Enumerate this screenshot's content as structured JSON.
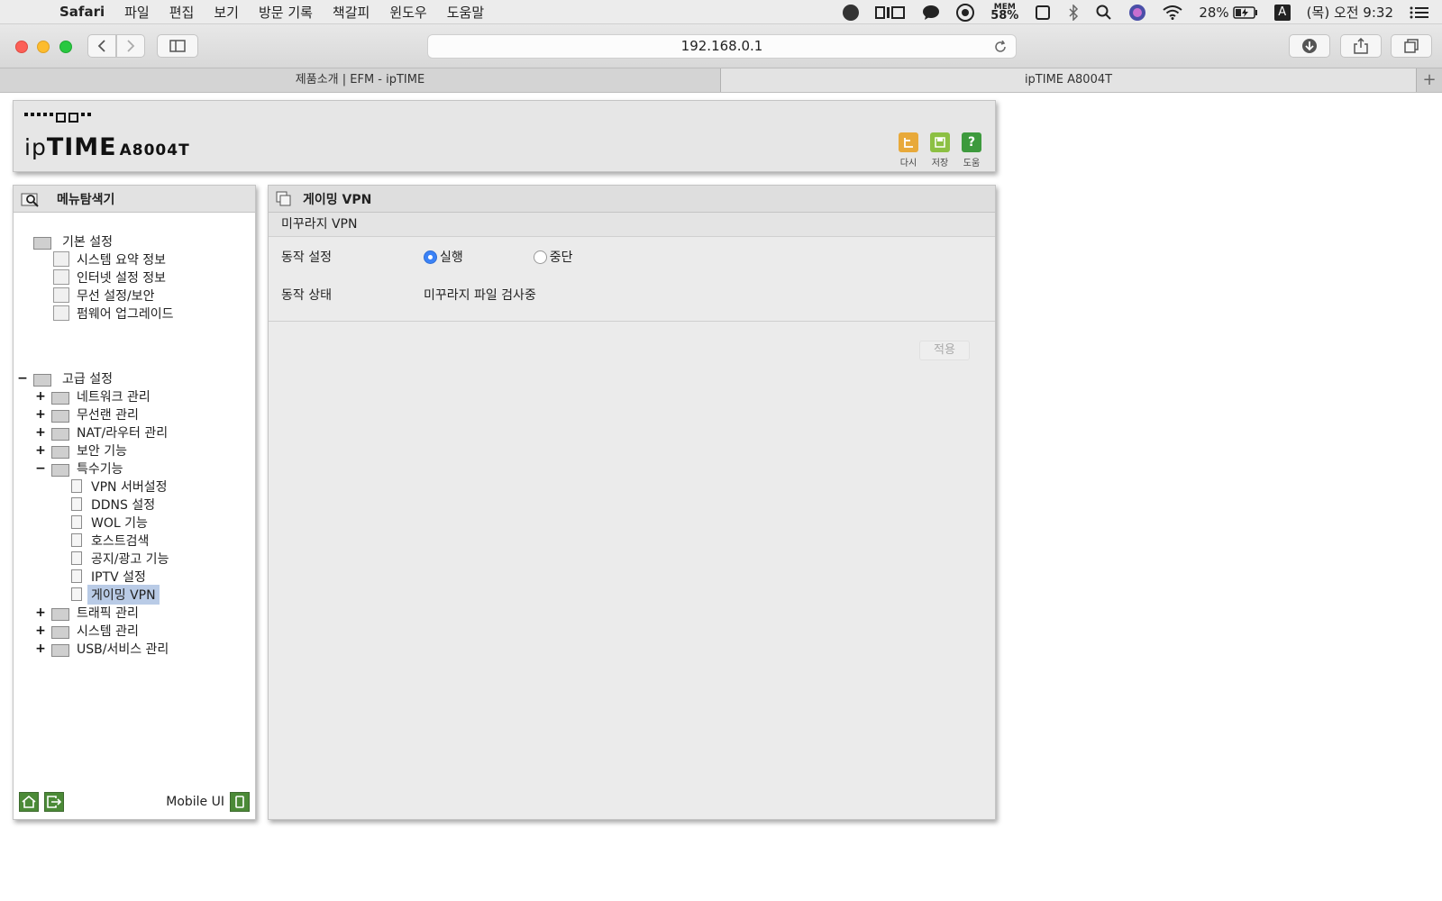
{
  "menubar": {
    "app": "Safari",
    "items": [
      "파일",
      "편집",
      "보기",
      "방문 기록",
      "책갈피",
      "윈도우",
      "도움말"
    ],
    "mem_label": "MEM",
    "mem_value": "58%",
    "battery": "28%",
    "input_source": "A",
    "clock": "(목) 오전 9:32"
  },
  "browser": {
    "url": "192.168.0.1",
    "tabs": [
      "제품소개 | EFM - ipTIME",
      "ipTIME A8004T"
    ],
    "new_tab": "+"
  },
  "header": {
    "brand_prefix": "ip",
    "brand_bold": "TIME",
    "model": "A8004T",
    "actions": [
      {
        "label": "다시",
        "icon": "undo-icon",
        "color": "#e8a93a"
      },
      {
        "label": "저장",
        "icon": "save-icon",
        "color": "#8cc043"
      },
      {
        "label": "도움",
        "icon": "help-icon",
        "color": "#3d9a3d"
      }
    ]
  },
  "nav": {
    "title": "메뉴탐색기",
    "basic": {
      "label": "기본 설정",
      "items": [
        "시스템 요약 정보",
        "인터넷 설정 정보",
        "무선 설정/보안",
        "펌웨어 업그레이드"
      ]
    },
    "advanced": {
      "label": "고급 설정",
      "toggle": "−",
      "groups": [
        {
          "label": "네트워크 관리",
          "toggle": "+"
        },
        {
          "label": "무선랜 관리",
          "toggle": "+"
        },
        {
          "label": "NAT/라우터 관리",
          "toggle": "+"
        },
        {
          "label": "보안 기능",
          "toggle": "+"
        },
        {
          "label": "특수기능",
          "toggle": "−"
        }
      ],
      "special_items": [
        "VPN 서버설정",
        "DDNS 설정",
        "WOL 기능",
        "호스트검색",
        "공지/광고 기능",
        "IPTV 설정",
        "게이밍 VPN"
      ],
      "selected": "게이밍 VPN",
      "groups_after": [
        {
          "label": "트래픽 관리",
          "toggle": "+"
        },
        {
          "label": "시스템 관리",
          "toggle": "+"
        },
        {
          "label": "USB/서비스 관리",
          "toggle": "+"
        }
      ]
    },
    "mobile_ui": "Mobile UI"
  },
  "main": {
    "title": "게이밍 VPN",
    "subtitle": "미꾸라지 VPN",
    "setting_label": "동작 설정",
    "option_run": "실행",
    "option_stop": "중단",
    "selected_option": "실행",
    "status_label": "동작 상태",
    "status_value": "미꾸라지 파일 검사중",
    "apply": "적용"
  }
}
